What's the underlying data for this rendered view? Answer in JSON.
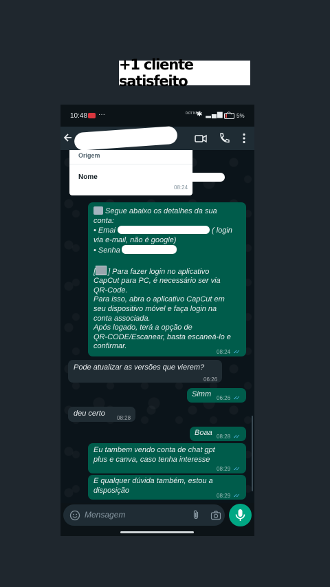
{
  "banner": {
    "text": "+1 cliente satisfeito"
  },
  "status_bar": {
    "time": "10:48",
    "more": "···",
    "net_speed": "0.07 KB/S",
    "battery": "5%"
  },
  "chat_header": {
    "icons": [
      "back-arrow-icon",
      "video-call-icon",
      "voice-call-icon",
      "more-vertical-icon"
    ]
  },
  "form_card": {
    "origin_label": "Origem",
    "name_label": "Nome",
    "time": "08:24"
  },
  "messages": [
    {
      "direction": "out",
      "lines": [
        "Segue abaixo os detalhes da sua",
        "conta:",
        "• Emai",
        "via e-mail, não é google)",
        "• Senha",
        "",
        "] Para fazer login no aplicativo",
        "CapCut para PC, é necessário ser via",
        "QR-Code.",
        "Para isso, abra o aplicativo CapCut em",
        "seu dispositivo móvel e faça login na",
        "conta associada.",
        "Após logado, terá a opção de",
        "QR-CODE/Escanear, basta escaneá-lo e",
        "confirmar."
      ],
      "email_suffix": "( login",
      "image_bracket": "[",
      "time": "08:24",
      "ticks": "✓✓"
    },
    {
      "direction": "in",
      "text": "Pode atualizar as versões que vierem?",
      "time": "06:26"
    },
    {
      "direction": "out",
      "text": "Simm",
      "time": "06:26",
      "ticks": "✓✓"
    },
    {
      "direction": "in",
      "text": "deu certo",
      "time": "08:28"
    },
    {
      "direction": "out",
      "text": "Boaa",
      "time": "08:28",
      "ticks": "✓✓"
    },
    {
      "direction": "out",
      "lines": [
        "Eu tambem vendo conta de chat gpt",
        "plus e canva, caso tenha interesse"
      ],
      "time": "08:29",
      "ticks": "✓✓"
    },
    {
      "direction": "out",
      "lines": [
        "E qualquer dúvida também, estou a",
        "disposição"
      ],
      "time": "08:29",
      "ticks": "✓✓"
    }
  ],
  "input": {
    "placeholder": "Mensagem"
  },
  "colors": {
    "incoming": "#202c33",
    "outgoing": "#005c4b",
    "accent": "#00a884",
    "read_ticks": "#53bdeb"
  }
}
